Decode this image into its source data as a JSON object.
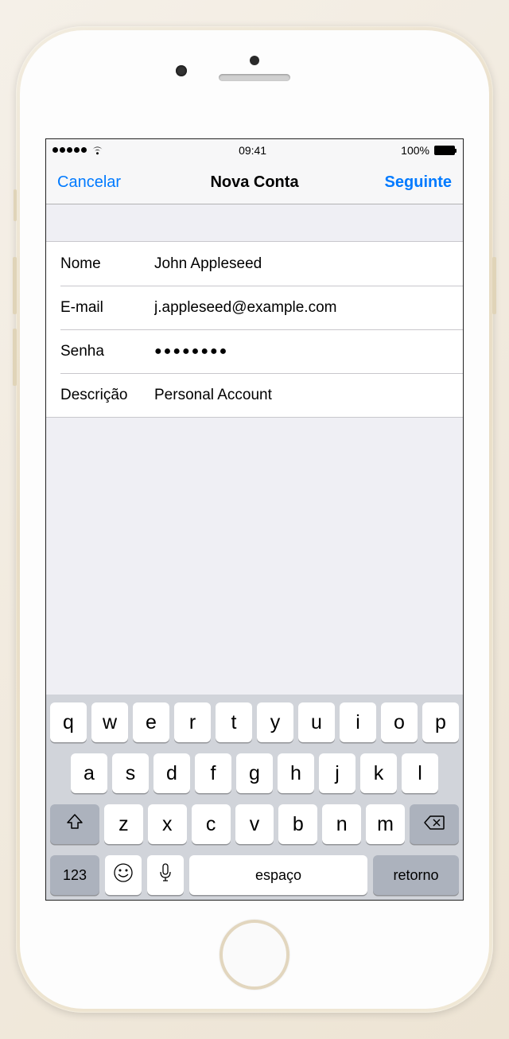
{
  "status": {
    "time": "09:41",
    "battery_pct": "100%"
  },
  "nav": {
    "cancel": "Cancelar",
    "title": "Nova Conta",
    "next": "Seguinte"
  },
  "form": {
    "name_label": "Nome",
    "name_value": "John Appleseed",
    "email_label": "E-mail",
    "email_value": "j.appleseed@example.com",
    "password_label": "Senha",
    "password_value": "●●●●●●●●",
    "description_label": "Descrição",
    "description_value": "Personal Account"
  },
  "keyboard": {
    "row1": [
      "q",
      "w",
      "e",
      "r",
      "t",
      "y",
      "u",
      "i",
      "o",
      "p"
    ],
    "row2": [
      "a",
      "s",
      "d",
      "f",
      "g",
      "h",
      "j",
      "k",
      "l"
    ],
    "row3": [
      "z",
      "x",
      "c",
      "v",
      "b",
      "n",
      "m"
    ],
    "numbers": "123",
    "space": "espaço",
    "return": "retorno"
  }
}
